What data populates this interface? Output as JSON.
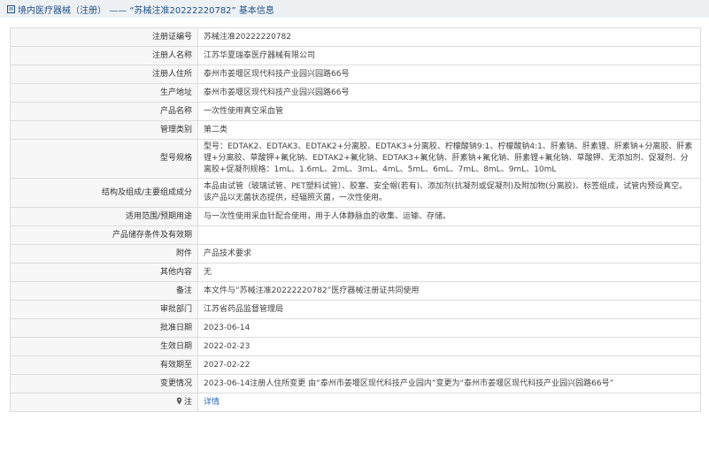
{
  "header": {
    "icon": "document-icon",
    "prefix": "境内医疗器械（注册）",
    "dash": "——",
    "quoted_title": "“苏械注准20222220782”",
    "suffix": "基本信息"
  },
  "rows": [
    {
      "label": "注册证编号",
      "value": "苏械注准20222220782"
    },
    {
      "label": "注册人名称",
      "value": "江苏华夏瑞泰医疗器械有限公司"
    },
    {
      "label": "注册人住所",
      "value": "泰州市姜堰区现代科技产业园兴园路66号"
    },
    {
      "label": "生产地址",
      "value": "泰州市姜堰区现代科技产业园兴园路66号"
    },
    {
      "label": "产品名称",
      "value": "一次性使用真空采血管"
    },
    {
      "label": "管理类别",
      "value": "第二类"
    },
    {
      "label": "型号规格",
      "value": "型号：EDTAK2、EDTAK3、EDTAK2+分离胶、EDTAK3+分离胶、柠檬酸钠9:1、柠檬酸钠4:1、肝素钠、肝素锂、肝素钠+分离胶、肝素锂+分离胶、草酸钾+氟化钠、EDTAK2+氟化钠、EDTAK3+氟化钠、肝素钠+氟化钠、肝素锂+氟化钠、草酸钾、无添加剂、促凝剂、分离胶+促凝剂规格：1mL、1.6mL、2mL、3mL、4mL、5mL、6mL、7mL、8mL、9mL、10mL"
    },
    {
      "label": "结构及组成/主要组成成分",
      "value": "本品由试管（玻璃试管、PET塑料试管）、胶塞、安全帽(若有)、添加剂(抗凝剂或促凝剂)及附加物(分离胶)、标签组成，试管内预设真空。该产品以无菌状态提供，经辐照灭菌，一次性使用。"
    },
    {
      "label": "适用范围/预期用途",
      "value": "与一次性使用采血针配合使用，用于人体静脉血的收集、运输、存储。"
    },
    {
      "label": "产品储存条件及有效期",
      "value": ""
    },
    {
      "label": "附件",
      "value": "产品技术要求"
    },
    {
      "label": "其他内容",
      "value": "无"
    },
    {
      "label": "备注",
      "value": "本文件与“苏械注准20222220782”医疗器械注册证共同使用"
    },
    {
      "label": "审批部门",
      "value": "江苏省药品监督管理局"
    },
    {
      "label": "批准日期",
      "value": "2023-06-14"
    },
    {
      "label": "生效日期",
      "value": "2022-02-23"
    },
    {
      "label": "有效期至",
      "value": "2027-02-22"
    },
    {
      "label": "变更情况",
      "value": "2023-06-14注册人住所变更 由“泰州市姜堰区现代科技产业园内”变更为“泰州市姜堰区现代科技产业园兴园路66号”"
    }
  ],
  "footer_row": {
    "label": "注",
    "icon": "map-pin-icon",
    "link": "详情"
  }
}
